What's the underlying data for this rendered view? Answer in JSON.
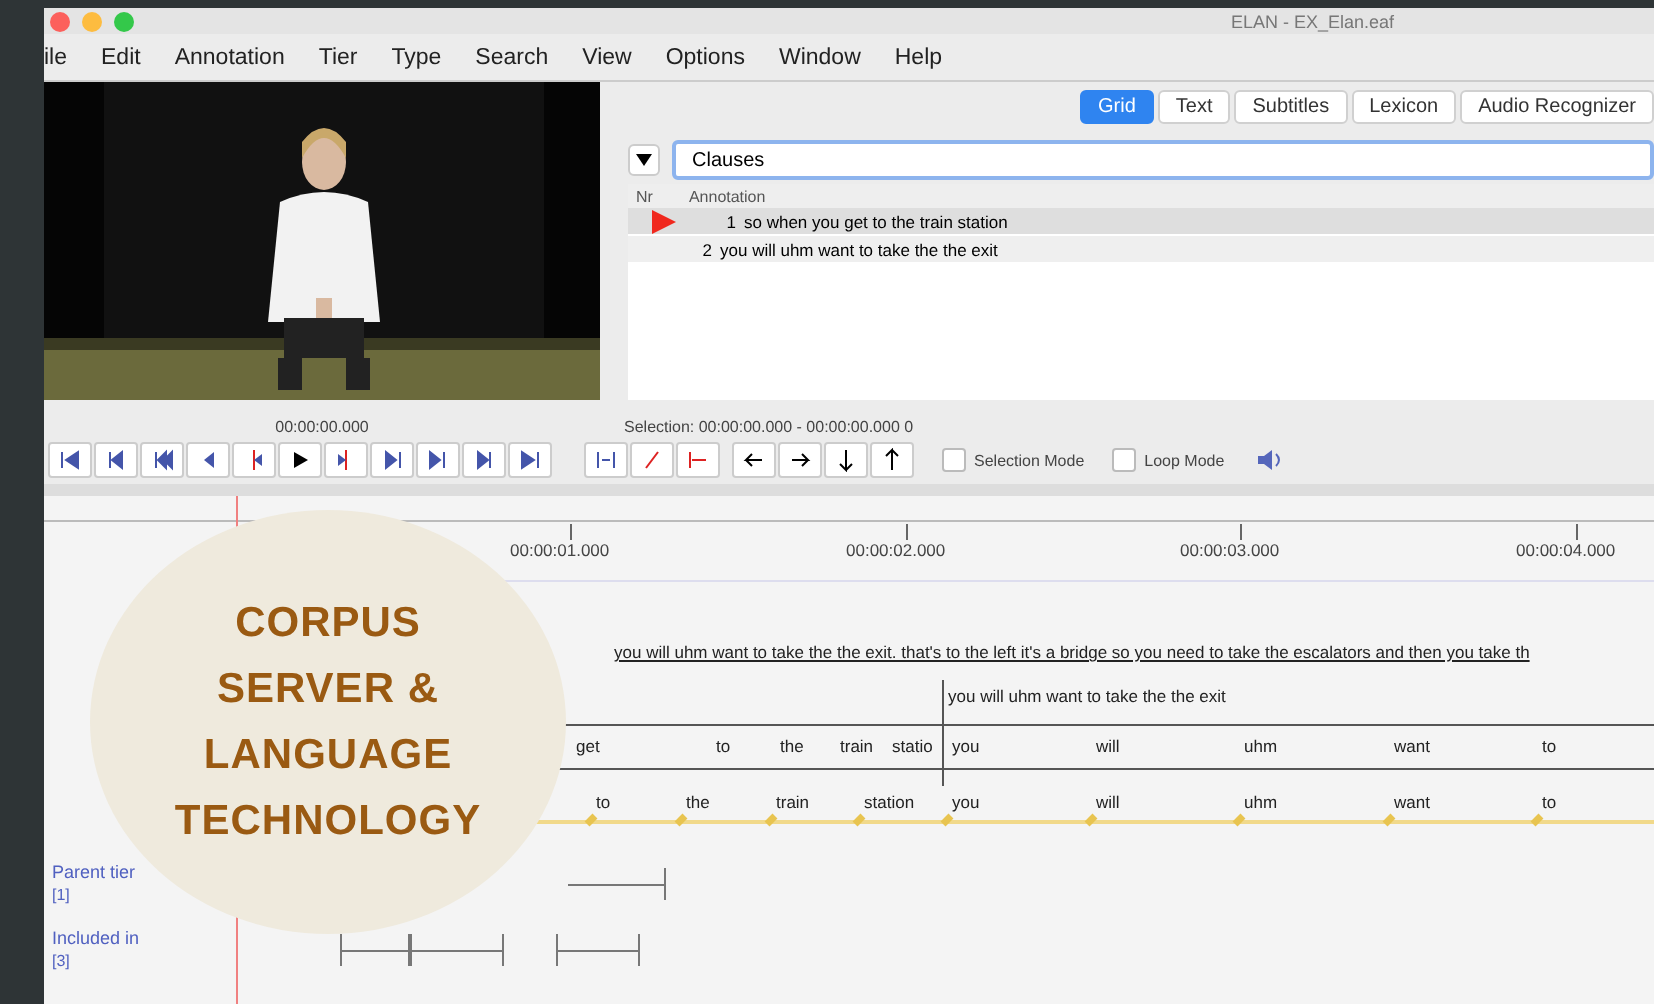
{
  "window": {
    "title": "ELAN - EX_Elan.eaf"
  },
  "menu": [
    "ile",
    "Edit",
    "Annotation",
    "Tier",
    "Type",
    "Search",
    "View",
    "Options",
    "Window",
    "Help"
  ],
  "video": {
    "kind": "picture",
    "timecode": "00:00:00.000"
  },
  "tabs": [
    {
      "label": "Grid",
      "selected": true
    },
    {
      "label": "Text",
      "selected": false
    },
    {
      "label": "Subtitles",
      "selected": false
    },
    {
      "label": "Lexicon",
      "selected": false
    },
    {
      "label": "Audio Recognizer",
      "selected": false
    }
  ],
  "grid": {
    "tier": "Clauses",
    "columns": [
      "Nr",
      "Annotation"
    ],
    "rows": [
      {
        "nr": "1",
        "annotation": "so when you get to the train station",
        "selected": true
      },
      {
        "nr": "2",
        "annotation": "you will uhm want to take the the exit",
        "selected": false
      }
    ]
  },
  "selection": "Selection: 00:00:00.000 - 00:00:00.000  0",
  "modes": [
    {
      "label": "Selection Mode",
      "checked": false
    },
    {
      "label": "Loop Mode",
      "checked": false
    }
  ],
  "ruler": [
    "00:00:01.000",
    "00:00:02.000",
    "00:00:03.000",
    "00:00:04.000"
  ],
  "tiers": [
    {
      "kind": "blank"
    },
    {
      "kind": "text",
      "annotations": [
        "you will uhm want to take the the exit. that's to the left it's a bridge so you need to take the escalators and then you take th"
      ]
    },
    {
      "kind": "clause",
      "annotations": [
        "you will uhm want to take the the exit"
      ]
    },
    {
      "kind": "words",
      "annotations": [
        "get",
        "to",
        "the",
        "train",
        "statio",
        "you",
        "will",
        "uhm",
        "want",
        "to"
      ]
    },
    {
      "kind": "symbolic",
      "annotations": [
        "to",
        "the",
        "train",
        "station",
        "you",
        "will",
        "uhm",
        "want",
        "to"
      ]
    },
    {
      "kind": "bars",
      "label": "Parent tier",
      "count": "[1]"
    },
    {
      "kind": "segments",
      "label": "Included in",
      "count": "[3]"
    }
  ],
  "badge": [
    "CORPUS",
    "SERVER &",
    "LANGUAGE",
    "TECHNOLOGY"
  ]
}
